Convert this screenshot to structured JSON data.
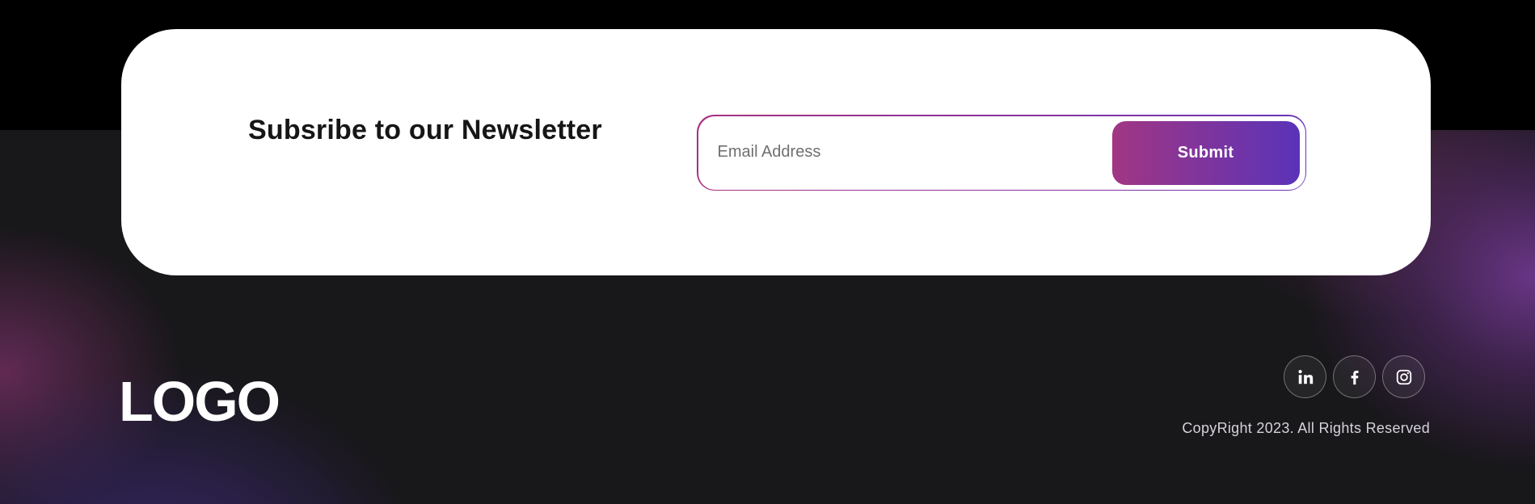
{
  "newsletter": {
    "title": "Subsribe to our Newsletter",
    "email_placeholder": "Email Address",
    "email_value": "",
    "submit_label": "Submit"
  },
  "footer": {
    "logo_text": "LOGO",
    "copyright": "CopyRight 2023. All Rights Reserved",
    "social_links": [
      {
        "icon": "linkedin-icon"
      },
      {
        "icon": "facebook-icon"
      },
      {
        "icon": "instagram-icon"
      }
    ]
  },
  "colors": {
    "gradient_start": "#a13683",
    "gradient_end": "#5a33b8",
    "footer_bg": "#18171a",
    "card_bg": "#ffffff"
  }
}
